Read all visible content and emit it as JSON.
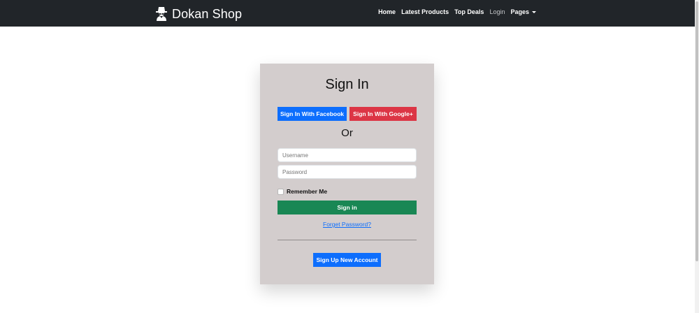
{
  "brand": {
    "name": "Dokan Shop",
    "icon": "user-secret-icon"
  },
  "nav": {
    "home": "Home",
    "latest_products": "Latest Products",
    "top_deals": "Top Deals",
    "login": "Login",
    "pages": "Pages"
  },
  "signin": {
    "title": "Sign In",
    "facebook_button": "Sign In With Facebook",
    "google_button": "Sign In With Google+",
    "or_text": "Or",
    "username_placeholder": "Username",
    "password_placeholder": "Password",
    "remember_label": "Remember Me",
    "signin_button": "Sign in",
    "forgot_link": "Forget Password?",
    "signup_button": "Sign Up New Account"
  },
  "colors": {
    "navbar": "#212529",
    "card": "#d3cdcd",
    "facebook": "#0d6efd",
    "google": "#dc3545",
    "signin": "#198754",
    "signup": "#0d6efd",
    "link": "#0d6efd"
  }
}
